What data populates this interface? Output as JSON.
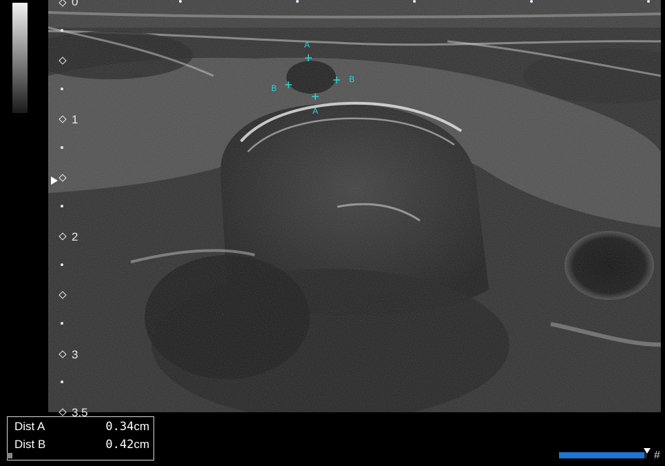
{
  "depth_scale": {
    "labels": [
      "0",
      "1",
      "2",
      "3",
      "3.5"
    ]
  },
  "calipers": {
    "a_label": "A",
    "b_label": "B",
    "color": "#25d7d7"
  },
  "measurements": [
    {
      "name": "Dist A",
      "value": "0.34",
      "unit": "cm"
    },
    {
      "name": "Dist B",
      "value": "0.42",
      "unit": "cm"
    }
  ],
  "progress": {
    "fraction": 0.97,
    "color": "#1f74d6"
  },
  "corner_symbol": "#"
}
